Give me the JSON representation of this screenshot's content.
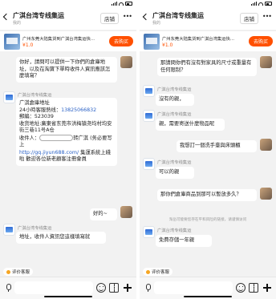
{
  "header": {
    "title": "广淇台湾专线集运",
    "subtitle": "我的",
    "shop_label": "店铺",
    "more_label": "•••"
  },
  "product": {
    "title_left": "广州东莞大陆集货到广淇台湾集运快递...",
    "title_right": "广州东莞大陆集货到广淇台湾集运快递...",
    "price": "¥1.0",
    "buy_label": "去购买"
  },
  "left_chat": {
    "msg1": "你好，請問可以提供一下你們的倉庫地址，以及在淘寶下單時收件人資訊應該怎麼填寫？",
    "shop_name": "广淇台湾专线集运",
    "addr_title": "广淇倉庫地址",
    "hotline": "24小時客服熱线：",
    "hotline_number": "13825066832",
    "zip": "郵編：523039",
    "addr": "收货地址:廣東省东莞市洪梅镇尧均村均安街三巷11号A仓",
    "recipient_prefix": "收件人：",
    "recipient_suffix": "转广淇 (务必要写上",
    "url": "http://gq.jiyun688.com/",
    "url_suffix": "集運系統上綫啦 歡迎各位新老顧客注冊會員",
    "reply_ok": "好的~",
    "shop_name2": "广淇台湾专线集运",
    "msg_last": "地址，收件人資訊您這樣填寫就",
    "rate_label": "评价客服"
  },
  "right_chat": {
    "msg1": "那請問你們有沒有對家具的尺寸或重量有任何限制？",
    "shop_name": "广淇台湾专线集运",
    "reply1": "沒有的親，",
    "shop_name2": "广淇台湾专线集运",
    "reply2": "親，需要寄送什麼物品呢",
    "msg2": "我想訂一個洗手臺與床頭櫃",
    "shop_name3": "广淇台湾专线集运",
    "reply3": "可以的親",
    "msg3": "那你們倉庫商品到那可以暫放多久？",
    "note": "淘岳可能要您存在平和风险的链接，请谨慎访问",
    "shop_name4": "广淇台湾专线集运",
    "reply4": "免費存儲一年親",
    "rate_label": "评价客服"
  }
}
